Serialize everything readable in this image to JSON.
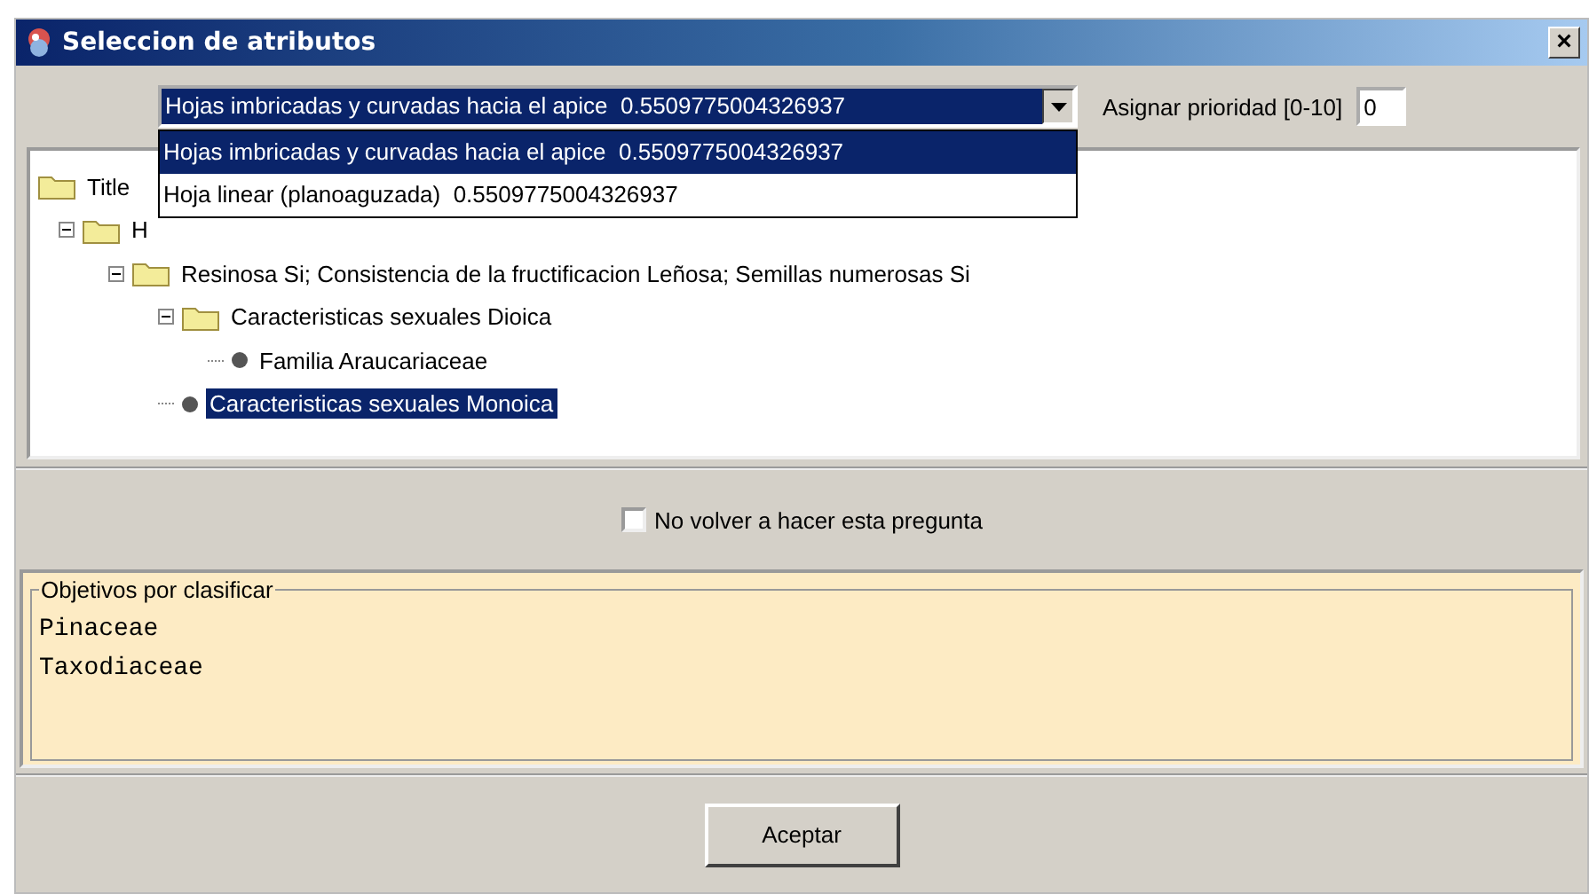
{
  "window": {
    "title": "Seleccion de atributos",
    "close": "×"
  },
  "combo": {
    "value": "Hojas imbricadas y curvadas hacia el apice  0.5509775004326937",
    "expanded": true,
    "options": [
      {
        "label": "Hojas imbricadas y curvadas hacia el apice  0.5509775004326937",
        "selected": true
      },
      {
        "label": "Hoja linear (planoaguzada)  0.5509775004326937",
        "selected": false
      }
    ]
  },
  "priority": {
    "label": "Asignar prioridad [0-10]",
    "value": "0"
  },
  "tree": [
    {
      "label": "Title",
      "kind": "folder",
      "expanded": true,
      "selected": false,
      "children": [
        {
          "label": "H",
          "kind": "folder",
          "expanded": true,
          "selected": false,
          "children": [
            {
              "label": "Resinosa Si; Consistencia de la fructificacion Leñosa; Semillas numerosas Si",
              "kind": "folder",
              "expanded": true,
              "selected": false,
              "children": [
                {
                  "label": "Caracteristicas sexuales Dioica",
                  "kind": "folder",
                  "expanded": true,
                  "selected": false,
                  "children": [
                    {
                      "label": "Familia Araucariaceae",
                      "kind": "leaf",
                      "selected": false
                    }
                  ]
                },
                {
                  "label": "Caracteristicas sexuales Monoica",
                  "kind": "leaf",
                  "selected": true
                }
              ]
            }
          ]
        }
      ]
    }
  ],
  "dont_ask": {
    "label": "No volver a hacer esta pregunta",
    "checked": false
  },
  "objectives": {
    "title": "Objetivos por clasificar",
    "items": [
      "Pinaceae",
      "Taxodiaceae"
    ]
  },
  "button": "Aceptar"
}
